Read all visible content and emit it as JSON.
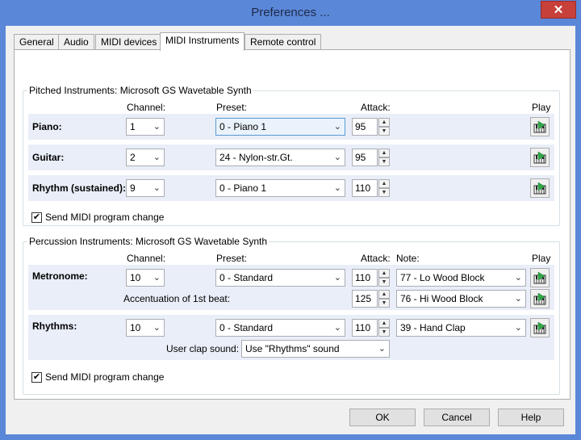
{
  "window": {
    "title": "Preferences ...",
    "close_glyph": "✕"
  },
  "tabs": [
    {
      "label": "General"
    },
    {
      "label": "Audio"
    },
    {
      "label": "MIDI devices"
    },
    {
      "label": "MIDI Instruments",
      "active": true
    },
    {
      "label": "Remote control"
    }
  ],
  "pitched": {
    "title": "Pitched Instruments: Microsoft GS Wavetable Synth",
    "headers": {
      "channel": "Channel:",
      "preset": "Preset:",
      "attack": "Attack:",
      "play": "Play"
    },
    "rows": [
      {
        "label": "Piano:",
        "channel": "1",
        "preset": "0 - Piano 1",
        "attack": "95"
      },
      {
        "label": "Guitar:",
        "channel": "2",
        "preset": "24 - Nylon-str.Gt.",
        "attack": "95"
      },
      {
        "label": "Rhythm (sustained):",
        "channel": "9",
        "preset": "0 - Piano 1",
        "attack": "110"
      }
    ],
    "send_program_change": {
      "label": "Send MIDI program change",
      "checked": true
    }
  },
  "percussion": {
    "title": "Percussion Instruments: Microsoft GS Wavetable Synth",
    "headers": {
      "channel": "Channel:",
      "preset": "Preset:",
      "attack": "Attack:",
      "note": "Note:",
      "play": "Play"
    },
    "metronome": {
      "label": "Metronome:",
      "channel": "10",
      "preset": "0 - Standard",
      "attack": "110",
      "note": "77 - Lo Wood Block",
      "accent_label": "Accentuation of 1st beat:",
      "accent_attack": "125",
      "accent_note": "76 - Hi Wood Block"
    },
    "rhythms": {
      "label": "Rhythms:",
      "channel": "10",
      "preset": "0 - Standard",
      "attack": "110",
      "note": "39 - Hand Clap",
      "clap_label": "User clap sound:",
      "clap_value": "Use \"Rhythms\" sound"
    },
    "send_program_change": {
      "label": "Send MIDI program change",
      "checked": true
    }
  },
  "buttons": {
    "ok": "OK",
    "cancel": "Cancel",
    "help": "Help"
  },
  "glyphs": {
    "chevron": "⌄",
    "up": "▲",
    "down": "▼",
    "check": "✔"
  },
  "icons": {
    "play": "play-note-icon"
  }
}
